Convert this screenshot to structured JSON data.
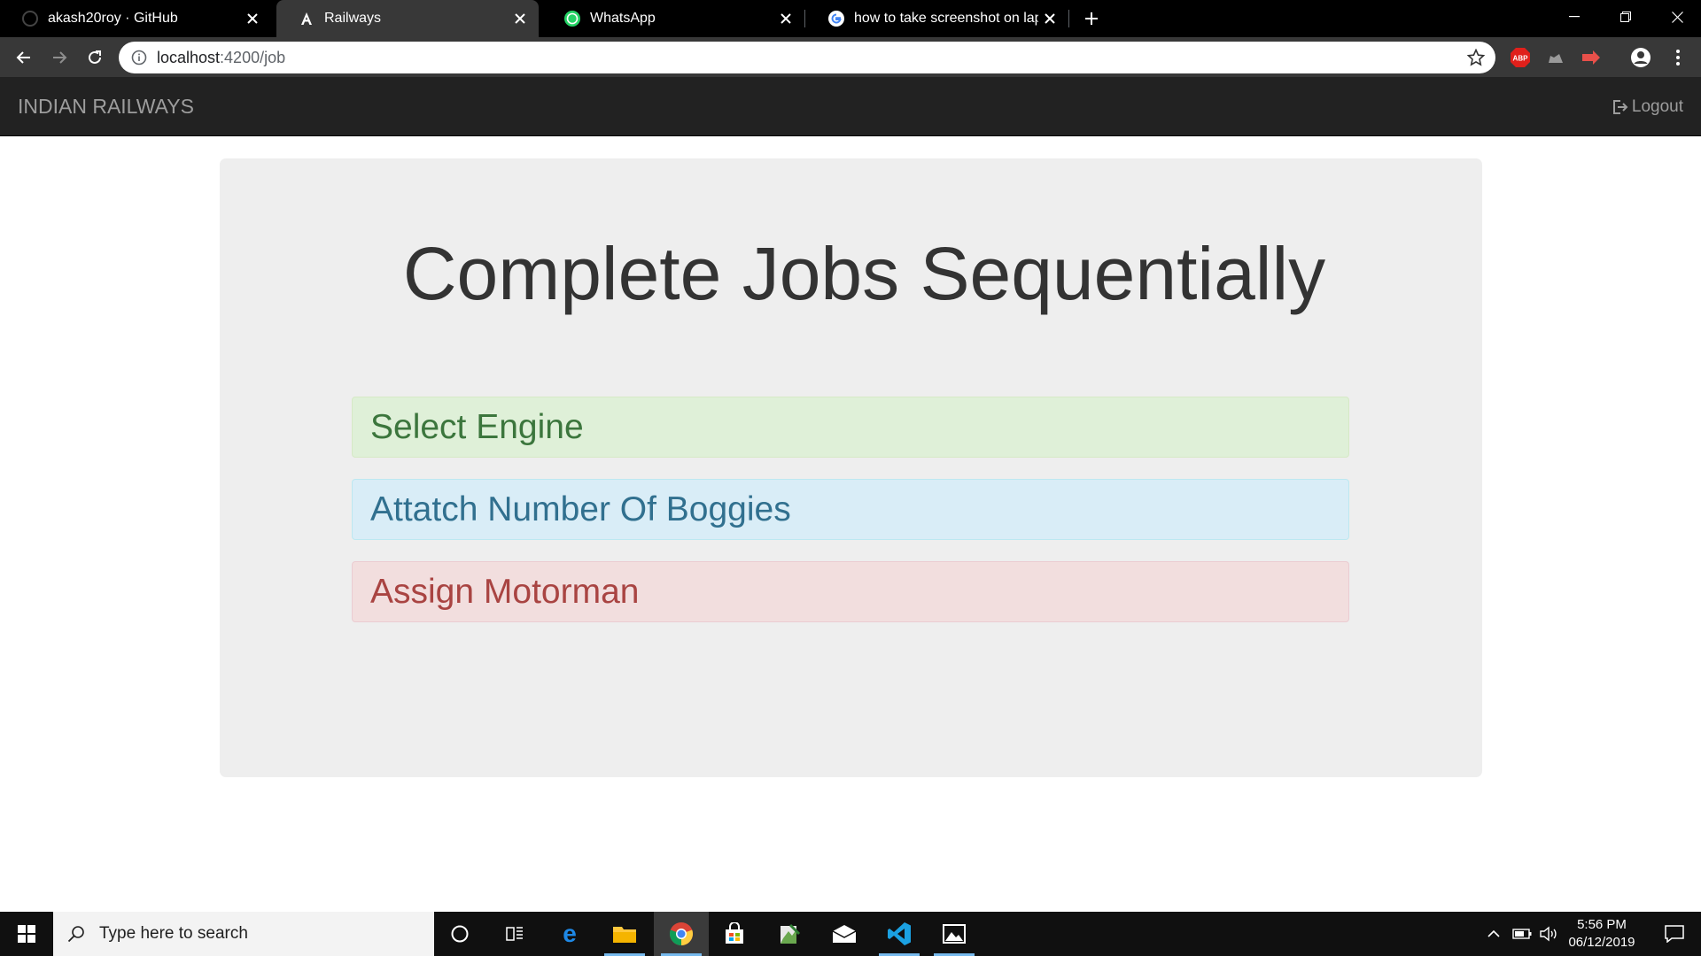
{
  "browser": {
    "tabs": [
      {
        "title": "akash20roy · GitHub",
        "icon": "github-icon",
        "active": false
      },
      {
        "title": "Railways",
        "icon": "angular-icon",
        "active": true
      },
      {
        "title": "WhatsApp",
        "icon": "whatsapp-icon",
        "active": false
      },
      {
        "title": "how to take screenshot on laptop",
        "icon": "google-icon",
        "active": false
      }
    ],
    "address": {
      "host": "localhost",
      "path": ":4200/job"
    },
    "extensions": [
      "adblock-icon",
      "cloud-extension-icon",
      "red-extension-icon",
      "profile-icon",
      "menu-icon"
    ]
  },
  "navbar": {
    "brand": "INDIAN RAILWAYS",
    "logout": "Logout"
  },
  "main": {
    "title": "Complete Jobs Sequentially",
    "jobs": [
      {
        "label": "Select Engine",
        "status": "success",
        "color": "#dff0d8"
      },
      {
        "label": "Attatch Number Of Boggies",
        "status": "info",
        "color": "#d9edf7"
      },
      {
        "label": "Assign Motorman",
        "status": "danger",
        "color": "#f2dede"
      }
    ]
  },
  "taskbar": {
    "search_placeholder": "Type here to search",
    "apps": [
      "cortana-icon",
      "task-view-icon",
      "edge-icon",
      "file-explorer-icon",
      "chrome-icon",
      "store-icon",
      "notepad-icon",
      "mail-icon",
      "vscode-icon",
      "photos-icon"
    ],
    "time": "5:56 PM",
    "date": "06/12/2019"
  }
}
